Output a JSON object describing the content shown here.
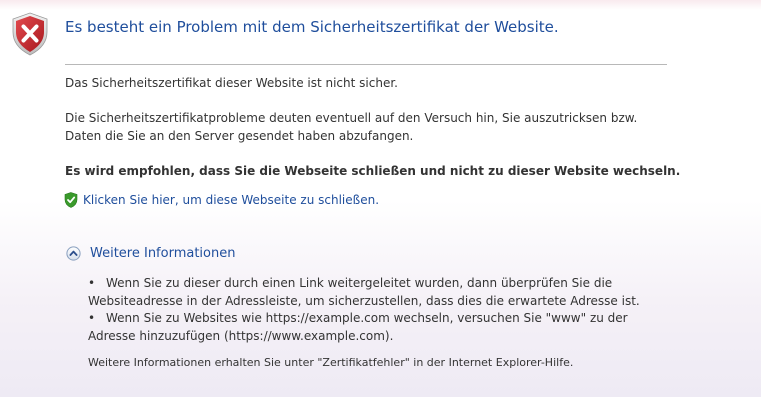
{
  "title": "Es besteht ein Problem mit dem Sicherheitszertifikat der Website.",
  "line1": "Das Sicherheitszertifikat dieser Website ist nicht sicher.",
  "para2": "Die Sicherheitszertifikatprobleme deuten eventuell auf den Versuch hin, Sie auszutricksen bzw. Daten die Sie an den Server gesendet haben abzufangen.",
  "recommendation": "Es wird empfohlen, dass Sie die Webseite schließen und nicht zu dieser Website wechseln.",
  "close_link": "Klicken Sie hier, um diese Webseite zu schließen.",
  "more_info": {
    "label": "Weitere Informationen",
    "bullet_char": "•",
    "bullets": [
      "Wenn Sie zu dieser durch einen Link weitergeleitet wurden, dann überprüfen Sie die Websiteadresse in der Adressleiste, um sicherzustellen, dass dies die erwartete Adresse ist.",
      "Wenn Sie zu Websites wie https://example.com wechseln, versuchen Sie \"www\" zu der Adresse hinzuzufügen (https://www.example.com)."
    ],
    "footer": "Weitere Informationen erhalten Sie unter \"Zertifikatfehler\" in der Internet Explorer-Hilfe."
  },
  "icons": {
    "error": "error-shield-icon",
    "close_link": "green-shield-check-icon",
    "expand": "collapse-chevron-up-icon"
  },
  "colors": {
    "title": "#1f4e9c",
    "link": "#1f4e9c",
    "error_shield": "#c8282d",
    "green_shield": "#3a9a2b"
  }
}
